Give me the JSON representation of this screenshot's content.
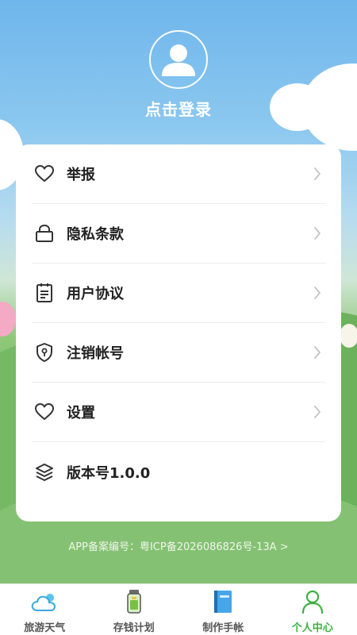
{
  "profile": {
    "login_label": "点击登录"
  },
  "menu": {
    "items": [
      {
        "label": "举报",
        "icon": "heart-icon"
      },
      {
        "label": "隐私条款",
        "icon": "lock-icon"
      },
      {
        "label": "用户协议",
        "icon": "clipboard-icon"
      },
      {
        "label": "注销帐号",
        "icon": "shield-icon"
      },
      {
        "label": "设置",
        "icon": "heart-icon"
      },
      {
        "label": "版本号1.0.0",
        "icon": "layers-icon"
      }
    ]
  },
  "footer": {
    "icp_text": "APP备案编号：粤ICP备2026086826号-13A >"
  },
  "tabbar": {
    "tabs": [
      {
        "label": "旅游天气",
        "icon": "cloud-icon"
      },
      {
        "label": "存钱计划",
        "icon": "money-jar-icon"
      },
      {
        "label": "制作手帐",
        "icon": "notebook-icon"
      },
      {
        "label": "个人中心",
        "icon": "person-icon",
        "active": true
      }
    ],
    "active_color": "#3cb043"
  }
}
